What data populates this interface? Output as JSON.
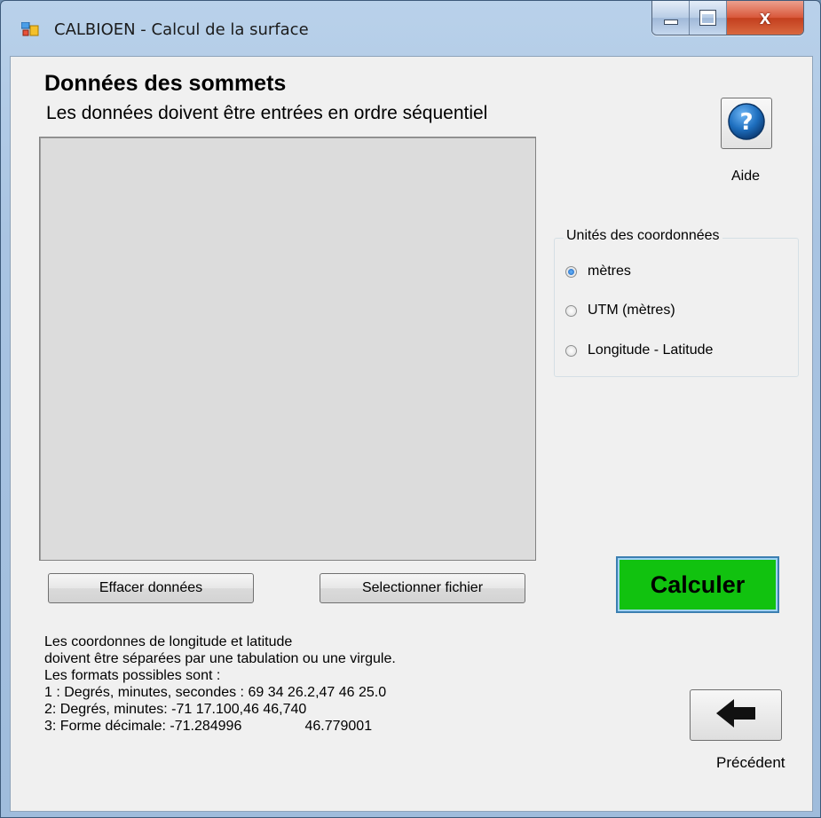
{
  "window": {
    "title": "CALBIOEN - Calcul de la surface",
    "controls": {
      "minimize": "minimize",
      "maximize": "maximize",
      "close": "x"
    }
  },
  "header": {
    "title": "Données des sommets",
    "subtitle": "Les données doivent être entrées en ordre séquentiel"
  },
  "help": {
    "label": "Aide",
    "icon": "question-icon"
  },
  "units_group": {
    "legend": "Unités des coordonnées",
    "options": [
      {
        "label": "mètres",
        "checked": true
      },
      {
        "label": "UTM (mètres)",
        "checked": false
      },
      {
        "label": "Longitude - Latitude",
        "checked": false
      }
    ]
  },
  "buttons": {
    "clear": "Effacer données",
    "select_file": "Selectionner fichier",
    "calculate": "Calculer"
  },
  "info_lines": [
    "Les coordonnes de longitude et latitude",
    "doivent être séparées par une tabulation ou une virgule.",
    "Les formats possibles sont :",
    "1 : Degrés, minutes, secondes : 69 34 26.2,47 46 25.0",
    "2: Degrés, minutes: -71 17.100,46 46,740",
    "3: Forme décimale: -71.284996                46.779001"
  ],
  "back": {
    "label": "Précédent",
    "icon": "arrow-left-icon"
  },
  "colors": {
    "calculate_bg": "#11c20f",
    "help_blue": "#1e6fbf"
  }
}
